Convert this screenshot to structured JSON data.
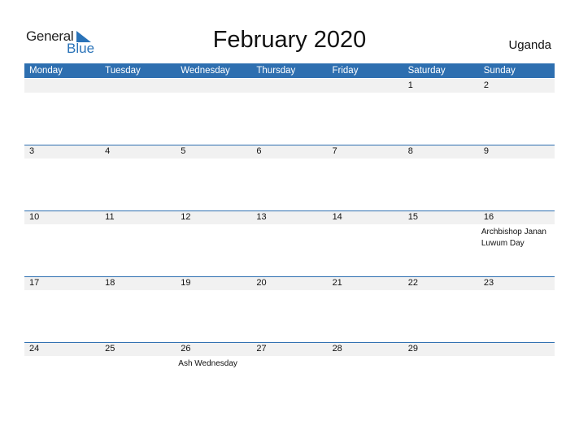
{
  "logo": {
    "general": "General",
    "blue": "Blue"
  },
  "title": "February 2020",
  "country": "Uganda",
  "colors": {
    "accent": "#2e6fb0",
    "date_bar": "#f1f1f1"
  },
  "weekdays": [
    "Monday",
    "Tuesday",
    "Wednesday",
    "Thursday",
    "Friday",
    "Saturday",
    "Sunday"
  ],
  "weeks": [
    {
      "days": [
        {
          "num": "",
          "event": ""
        },
        {
          "num": "",
          "event": ""
        },
        {
          "num": "",
          "event": ""
        },
        {
          "num": "",
          "event": ""
        },
        {
          "num": "",
          "event": ""
        },
        {
          "num": "1",
          "event": ""
        },
        {
          "num": "2",
          "event": ""
        }
      ]
    },
    {
      "days": [
        {
          "num": "3",
          "event": ""
        },
        {
          "num": "4",
          "event": ""
        },
        {
          "num": "5",
          "event": ""
        },
        {
          "num": "6",
          "event": ""
        },
        {
          "num": "7",
          "event": ""
        },
        {
          "num": "8",
          "event": ""
        },
        {
          "num": "9",
          "event": ""
        }
      ]
    },
    {
      "days": [
        {
          "num": "10",
          "event": ""
        },
        {
          "num": "11",
          "event": ""
        },
        {
          "num": "12",
          "event": ""
        },
        {
          "num": "13",
          "event": ""
        },
        {
          "num": "14",
          "event": ""
        },
        {
          "num": "15",
          "event": ""
        },
        {
          "num": "16",
          "event": "Archbishop Janan Luwum Day"
        }
      ]
    },
    {
      "days": [
        {
          "num": "17",
          "event": ""
        },
        {
          "num": "18",
          "event": ""
        },
        {
          "num": "19",
          "event": ""
        },
        {
          "num": "20",
          "event": ""
        },
        {
          "num": "21",
          "event": ""
        },
        {
          "num": "22",
          "event": ""
        },
        {
          "num": "23",
          "event": ""
        }
      ]
    },
    {
      "days": [
        {
          "num": "24",
          "event": ""
        },
        {
          "num": "25",
          "event": ""
        },
        {
          "num": "26",
          "event": "Ash Wednesday"
        },
        {
          "num": "27",
          "event": ""
        },
        {
          "num": "28",
          "event": ""
        },
        {
          "num": "29",
          "event": ""
        },
        {
          "num": "",
          "event": ""
        }
      ]
    }
  ]
}
